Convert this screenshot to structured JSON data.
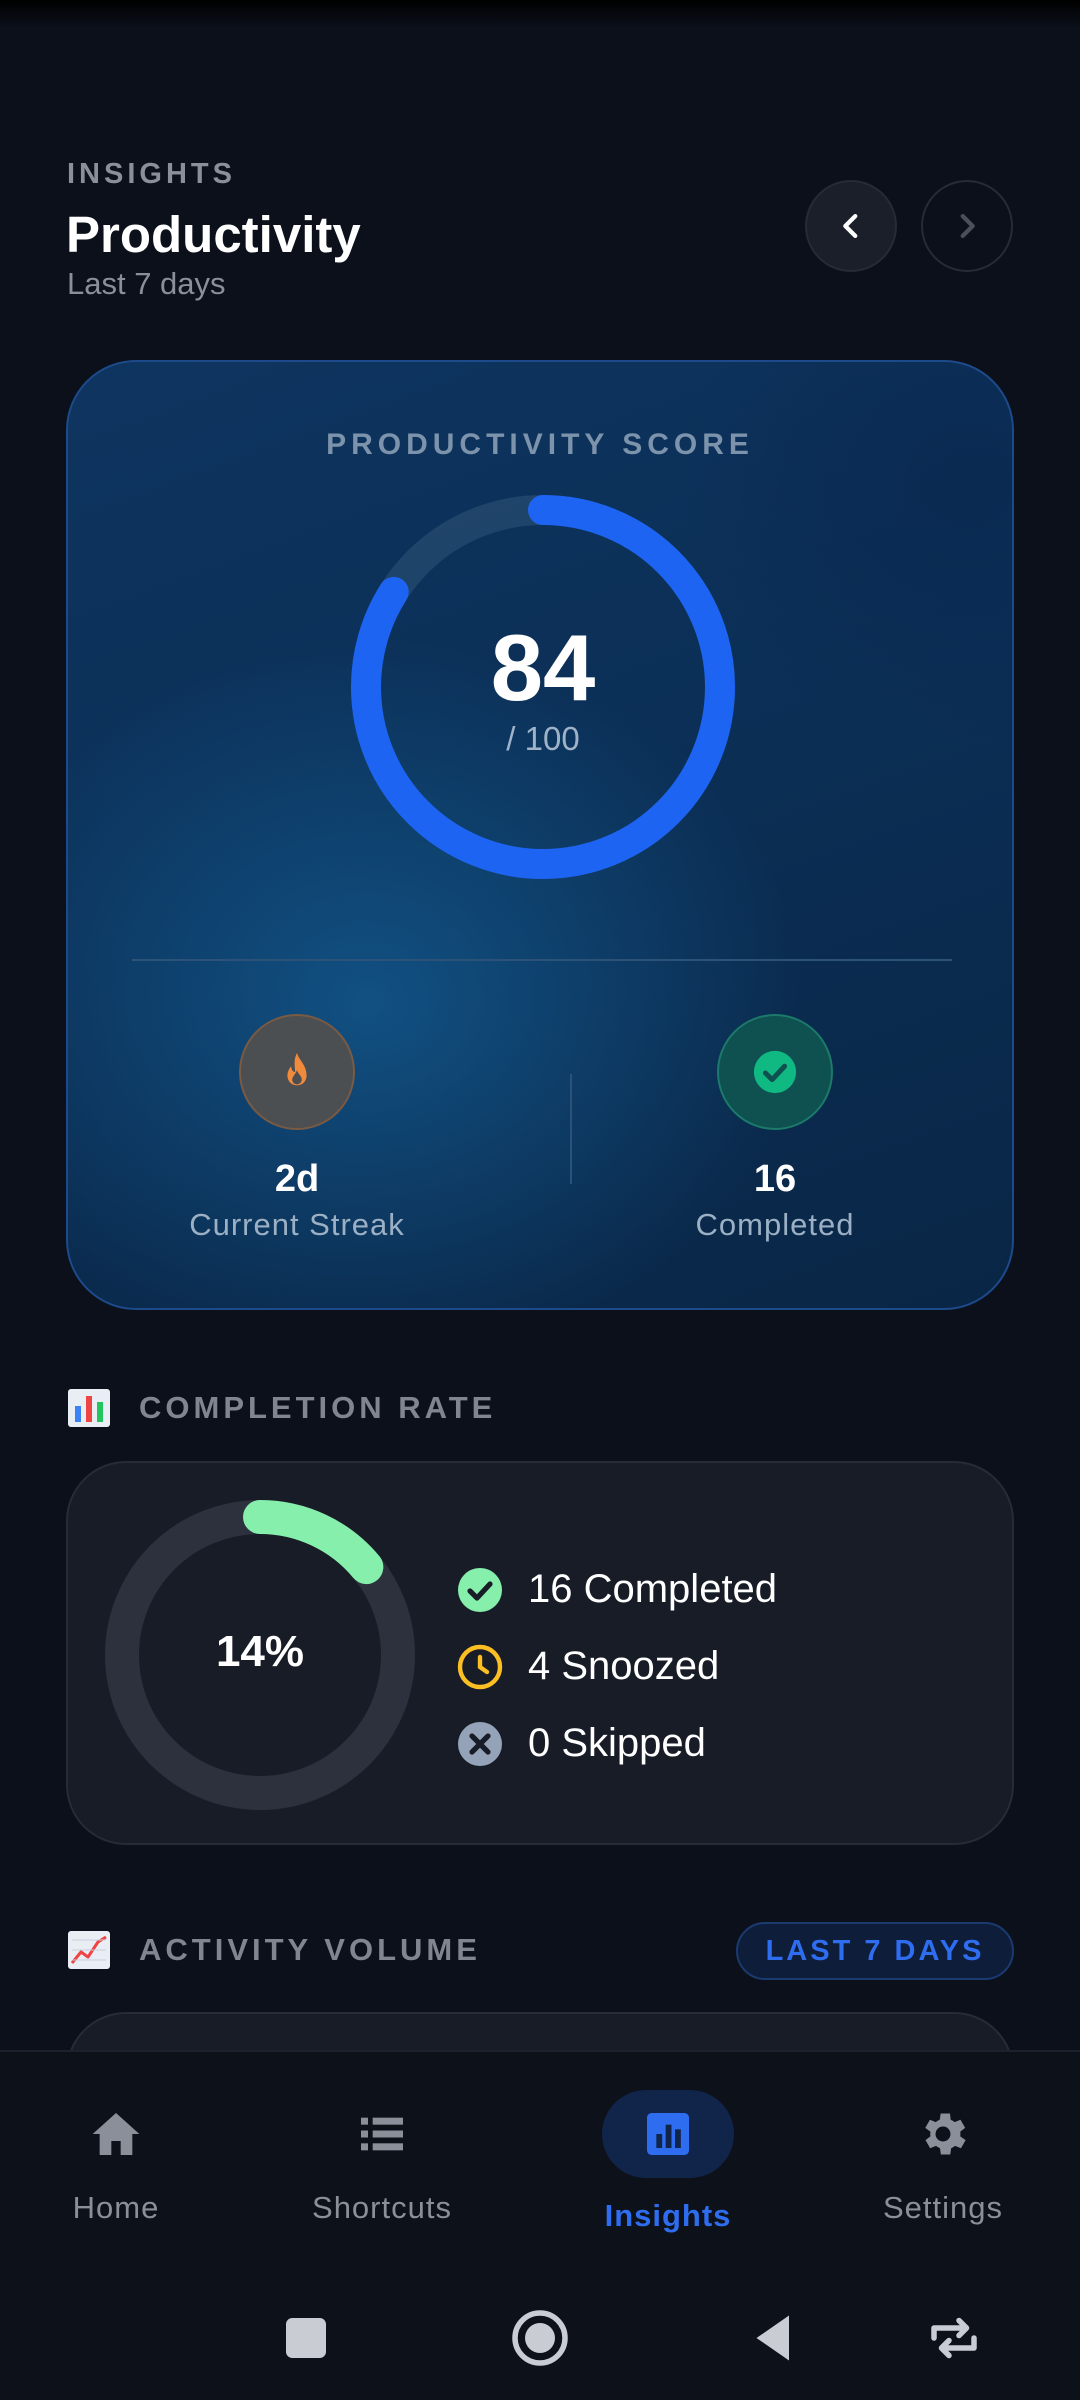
{
  "header": {
    "eyebrow": "INSIGHTS",
    "title": "Productivity",
    "subtitle": "Last 7 days"
  },
  "score_card": {
    "label": "PRODUCTIVITY SCORE",
    "score": "84",
    "max": "/ 100",
    "score_fraction": 0.84,
    "streak": {
      "value": "2d",
      "label": "Current Streak"
    },
    "completed": {
      "value": "16",
      "label": "Completed"
    }
  },
  "completion": {
    "title": "COMPLETION RATE",
    "percent_label": "14%",
    "percent_fraction": 0.14,
    "items": [
      {
        "label": "16 Completed",
        "icon": "check-circle-icon",
        "color": "#86efac"
      },
      {
        "label": "4 Snoozed",
        "icon": "clock-icon",
        "color": "#fbbf24"
      },
      {
        "label": "0 Skipped",
        "icon": "x-circle-icon",
        "color": "#94a3b8"
      }
    ]
  },
  "activity": {
    "title": "ACTIVITY VOLUME",
    "range": "LAST 7 DAYS"
  },
  "bottom_nav": {
    "tabs": [
      {
        "label": "Home",
        "icon": "home-icon"
      },
      {
        "label": "Shortcuts",
        "icon": "list-icon"
      },
      {
        "label": "Insights",
        "icon": "bar-chart-icon",
        "active": true
      },
      {
        "label": "Settings",
        "icon": "gear-icon"
      }
    ]
  },
  "colors": {
    "accent": "#2f6df0",
    "ring_blue": "#1d64f2",
    "green": "#86efac",
    "amber": "#fbbf24"
  }
}
